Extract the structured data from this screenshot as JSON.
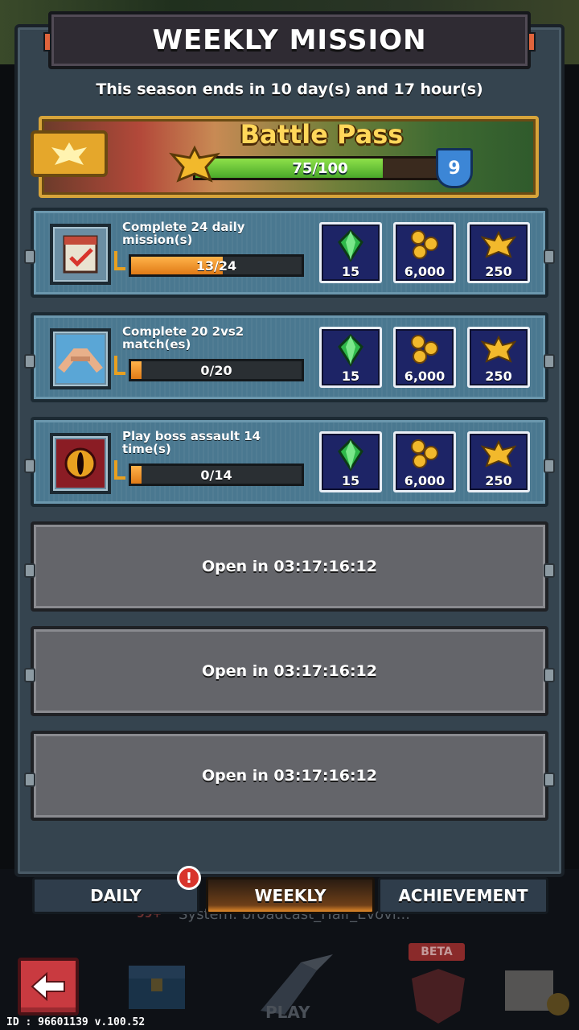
{
  "header": {
    "title": "WEEKLY MISSION"
  },
  "season": {
    "text": "This season ends in 10 day(s) and 17 hour(s)"
  },
  "battle_pass": {
    "title": "Battle Pass",
    "progress_text": "75/100",
    "progress_fraction": 0.75,
    "level": "9"
  },
  "missions": [
    {
      "label": "Complete 24 daily mission(s)",
      "icon": "calendar-check-icon",
      "progress_text": "13/24",
      "progress_fraction": 0.54,
      "rewards": [
        {
          "icon": "green-gem-icon",
          "amount": "15"
        },
        {
          "icon": "gold-coins-icon",
          "amount": "6,000"
        },
        {
          "icon": "eagle-emblem-icon",
          "amount": "250"
        }
      ]
    },
    {
      "label": "Complete 20 2vs2 match(es)",
      "icon": "handshake-icon",
      "progress_text": "0/20",
      "progress_fraction": 0,
      "rewards": [
        {
          "icon": "green-gem-icon",
          "amount": "15"
        },
        {
          "icon": "gold-coins-icon",
          "amount": "6,000"
        },
        {
          "icon": "eagle-emblem-icon",
          "amount": "250"
        }
      ]
    },
    {
      "label": "Play boss assault 14 time(s)",
      "icon": "boss-eye-icon",
      "progress_text": "0/14",
      "progress_fraction": 0,
      "rewards": [
        {
          "icon": "green-gem-icon",
          "amount": "15"
        },
        {
          "icon": "gold-coins-icon",
          "amount": "6,000"
        },
        {
          "icon": "eagle-emblem-icon",
          "amount": "250"
        }
      ]
    }
  ],
  "locked_slots": [
    {
      "text": "Open in 03:17:16:12"
    },
    {
      "text": "Open in 03:17:16:12"
    },
    {
      "text": "Open in 03:17:16:12"
    }
  ],
  "tabs": [
    {
      "label": "DAILY",
      "active": false,
      "alert": "!"
    },
    {
      "label": "WEEKLY",
      "active": true
    },
    {
      "label": "ACHIEVEMENT",
      "active": false
    }
  ],
  "background": {
    "broadcast_text": "System: broadcast_Half_Evovl...",
    "broadcast_badge": "99+",
    "play_label": "PLAY",
    "beta_label": "BETA"
  },
  "footer": {
    "version": "ID : 96601139 v.100.52"
  },
  "colors": {
    "panel": "#35444f",
    "mission_card": "#4a7890",
    "locked_card": "#64656a",
    "reward_tile": "#1d2466",
    "progress_orange": "#e07a16",
    "progress_green": "#4aa82a",
    "active_tab": "#e48a2a",
    "back_button": "#c93a40"
  }
}
